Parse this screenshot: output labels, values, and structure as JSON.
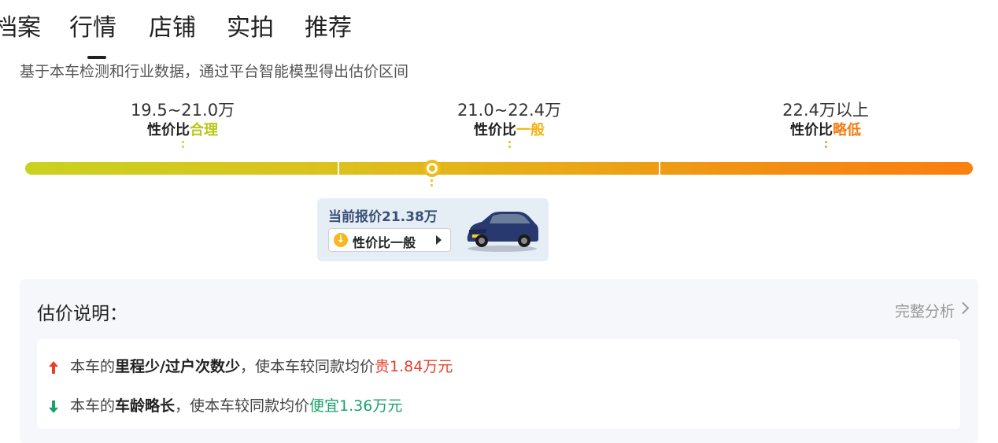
{
  "tabs": [
    "档案",
    "行情",
    "店铺",
    "实拍",
    "推荐"
  ],
  "active_tab": "行情",
  "subtitle": "基于本车检测和行业数据，通过平台智能模型得出估价区间",
  "ranges": [
    {
      "price": "19.5~21.0万",
      "prefix": "性价比",
      "level": "合理",
      "color": "#b8c716"
    },
    {
      "price": "21.0~22.4万",
      "prefix": "性价比",
      "level": "一般",
      "color": "#f2b414"
    },
    {
      "price": "22.4万以上",
      "prefix": "性价比",
      "level": "略低",
      "color": "#f67b10"
    }
  ],
  "current": {
    "text": "当前报价21.38万",
    "badge": "性价比一般",
    "level_icon": "arrow-down-circle-icon",
    "car_image": "blue-suv-thumbnail"
  },
  "explain": {
    "title": "估价说明：",
    "full_link": "完整分析",
    "items": [
      {
        "direction": "up",
        "icon": "arrow-up-icon",
        "pre": "本车的",
        "bold": "里程少/过户次数少",
        "mid": "，使本车较同款均价",
        "effect": "贵1.84万元",
        "color": "#e2412a"
      },
      {
        "direction": "down",
        "icon": "arrow-down-icon",
        "pre": "本车的",
        "bold": "车龄略长",
        "mid": "，使本车较同款均价",
        "effect": "便宜1.36万元",
        "color": "#1aa16a"
      }
    ]
  }
}
